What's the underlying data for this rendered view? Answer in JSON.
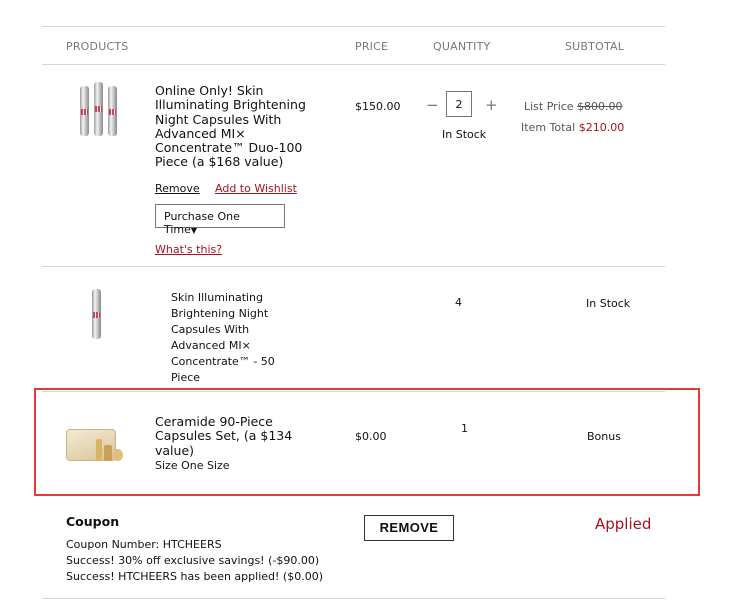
{
  "header": {
    "products": "PRODUCTS",
    "price": "PRICE",
    "quantity": "QUANTITY",
    "subtotal": "SUBTOTAL"
  },
  "items": [
    {
      "name": "Online Only! Skin Illuminating Brightening Night Capsules With Advanced MI× Concentrate™ Duo-100 Piece (a $168 value)",
      "price": "$150.00",
      "quantity": "2",
      "minus": "−",
      "plus": "+",
      "stock": "In Stock",
      "list_price_label": "List Price",
      "list_price": "$800.00",
      "item_total_label": "Item Total",
      "item_total": "$210.00",
      "remove": "Remove",
      "add_to_wishlist": "Add to Wishlist",
      "purchase_option": "Purchase One Time",
      "whats_this": "What's this?"
    },
    {
      "name_lines": [
        "Skin Illuminating",
        "Brightening Night",
        "Capsules With",
        "Advanced MI×",
        "Concentrate™ - 50",
        "Piece"
      ],
      "quantity": "4",
      "stock": "In Stock"
    },
    {
      "name": "Ceramide 90-Piece Capsules Set, (a $134 value)",
      "size": "Size One Size",
      "price": "$0.00",
      "quantity": "1",
      "subtotal": "Bonus"
    }
  ],
  "coupon": {
    "title": "Coupon",
    "number": "Coupon Number: HTCHEERS",
    "line1": "Success! 30% off exclusive savings! (-$90.00)",
    "line2": "Success! HTCHEERS has been applied! ($0.00)",
    "remove_button": "REMOVE",
    "status": "Applied"
  },
  "colors": {
    "accent_red": "#a6121d",
    "highlight_border": "#e53935"
  }
}
